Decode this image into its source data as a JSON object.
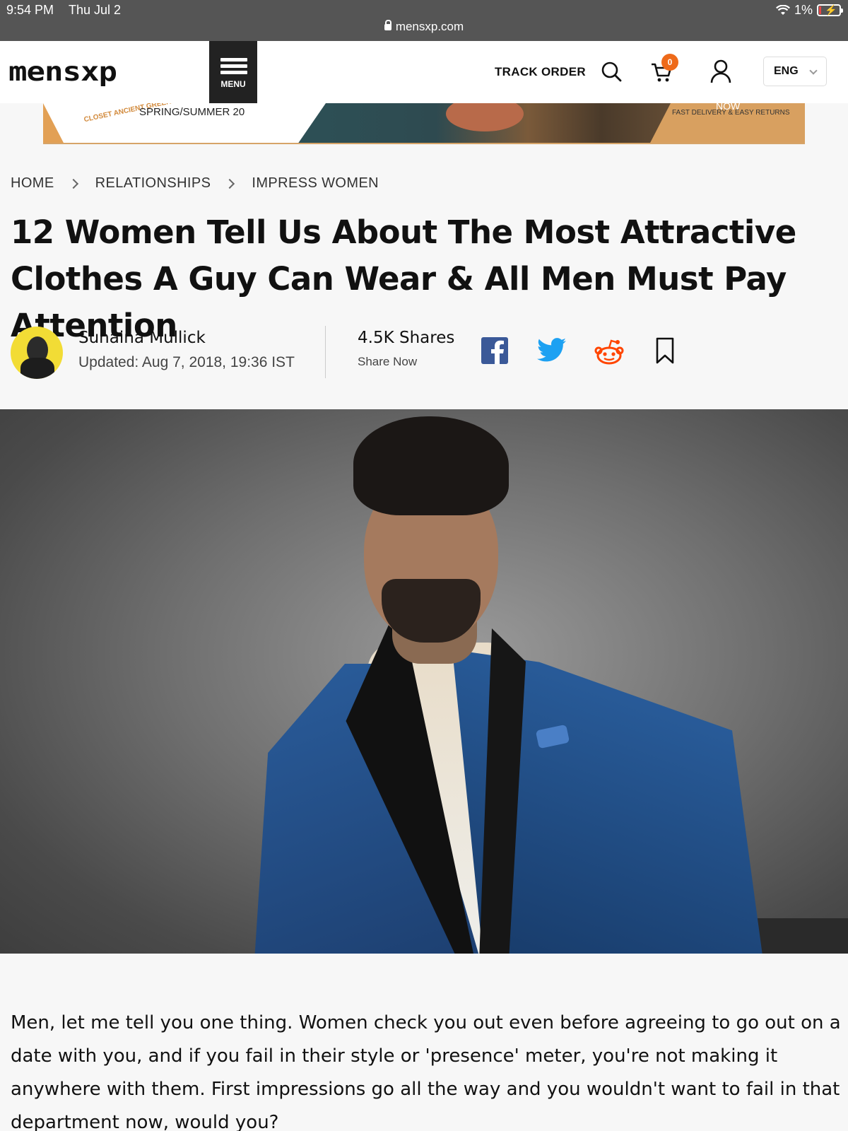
{
  "status_bar": {
    "time": "9:54 PM",
    "date": "Thu Jul 2",
    "battery": "1%",
    "battery_level": 0.01,
    "url": "mensxp.com"
  },
  "header": {
    "logo": "mensxp",
    "menu_label": "MENU",
    "track_order": "TRACK ORDER",
    "cart_count": "0",
    "language": "ENG"
  },
  "banner": {
    "logo_text": "CLOSET ANCIENT GREEK SANDALS",
    "season": "SPRING/SUMMER 20",
    "now": "NOW",
    "delivery": "FAST DELIVERY & EASY RETURNS"
  },
  "breadcrumb": {
    "items": [
      "HOME",
      "RELATIONSHIPS",
      "IMPRESS WOMEN"
    ]
  },
  "article": {
    "title": "12 Women Tell Us About The Most Attractive Clothes A Guy Can Wear & All Men Must Pay Attention",
    "author": "Sunaina Mullick",
    "updated": "Updated: Aug 7, 2018, 19:36 IST",
    "shares": "4.5K Shares",
    "share_now": "Share Now",
    "body": "Men, let me tell you one thing. Women check you out even before agreeing to go out on a date with you, and if you fail in their style or 'presence' meter, you're not making it anywhere with them. First impressions go all the way and you wouldn't want to fail in that department now, would you?"
  },
  "colors": {
    "status_bar": "#555555",
    "accent_orange": "#ee6a1a",
    "facebook": "#3b5998",
    "twitter": "#1da1f2",
    "reddit": "#ff4500"
  },
  "icons": [
    "lock-icon",
    "menu-icon",
    "search-icon",
    "cart-icon",
    "user-icon",
    "chevron-down-icon",
    "chevron-right-icon",
    "facebook-icon",
    "twitter-icon",
    "reddit-icon",
    "bookmark-icon"
  ]
}
